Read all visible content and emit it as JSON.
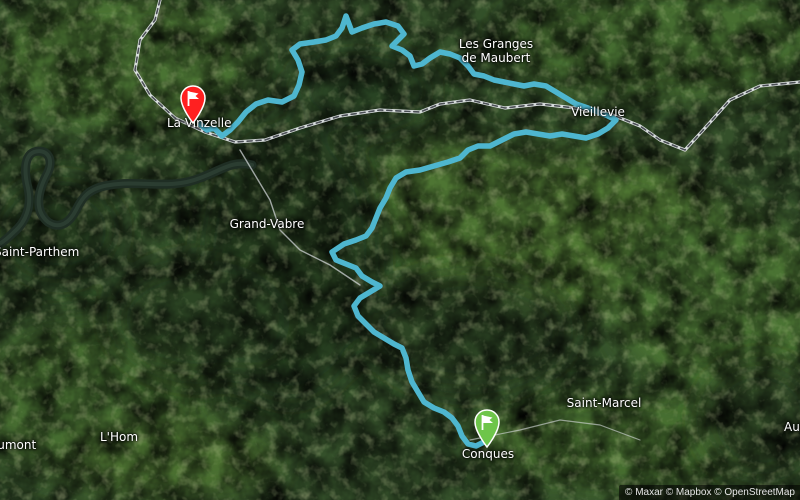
{
  "map": {
    "route_color": "#4eb6cf",
    "start_marker_color": "#ff2020",
    "finish_marker_color": "#6ec54a",
    "start_marker": {
      "icon": "flag-pin-icon",
      "color": "#ff2020"
    },
    "finish_marker": {
      "icon": "flag-pin-icon",
      "color": "#6ec54a"
    }
  },
  "places": {
    "la_vinzelle": "La Vinzelle",
    "les_granges_line1": "Les Granges",
    "les_granges_line2": "de Maubert",
    "vieillevie": "Vieillevie",
    "grand_vabre": "Grand-Vabre",
    "saint_parthem": "Saint-Parthem",
    "saint_marcel": "Saint-Marcel",
    "conques": "Conques",
    "lhom": "L'Hom",
    "aumont": "Aumont",
    "aus": "Aus"
  },
  "attribution": "© Maxar © Mapbox © OpenStreetMap"
}
